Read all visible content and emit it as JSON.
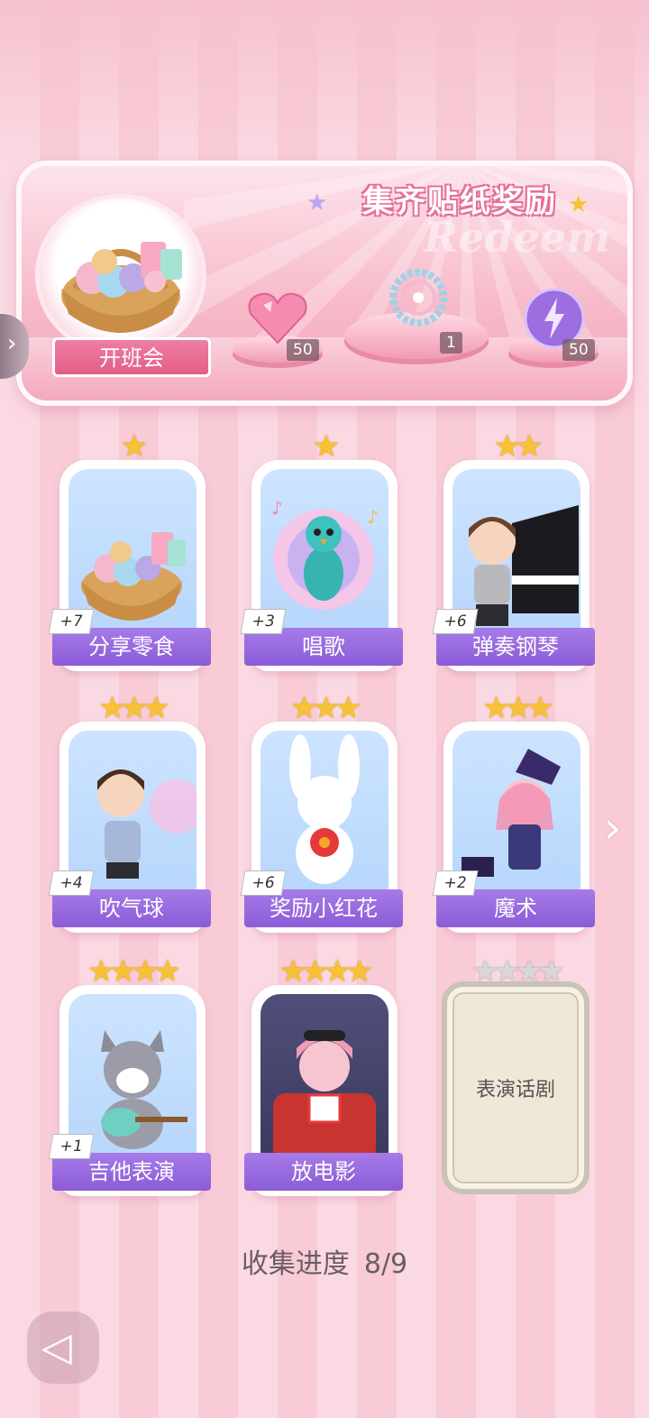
{
  "banner": {
    "title": "集齐贴纸奖励",
    "watermark": "Redeem",
    "class_meeting_label": "开班会",
    "rewards": [
      {
        "name": "pink-heart-gem",
        "count": "50"
      },
      {
        "name": "bracelet",
        "count": "1"
      },
      {
        "name": "purple-lightning-orb",
        "count": "50"
      }
    ]
  },
  "stickers": [
    {
      "label": "分享零食",
      "bonus": "+7",
      "stars": "★"
    },
    {
      "label": "唱歌",
      "bonus": "+3",
      "stars": "★"
    },
    {
      "label": "弹奏钢琴",
      "bonus": "+6",
      "stars": "★★"
    },
    {
      "label": "吹气球",
      "bonus": "+4",
      "stars": "★★★"
    },
    {
      "label": "奖励小红花",
      "bonus": "+6",
      "stars": "★★★"
    },
    {
      "label": "魔术",
      "bonus": "+2",
      "stars": "★★★"
    },
    {
      "label": "吉他表演",
      "bonus": "+1",
      "stars": "★★★★"
    },
    {
      "label": "放电影",
      "bonus": "",
      "stars": "★★★★"
    },
    {
      "label": "表演话剧",
      "bonus": "",
      "stars": "★★★★",
      "locked": true
    }
  ],
  "progress": {
    "label": "收集进度",
    "value": "8/9"
  },
  "icons": {
    "next": "chevron-right-icon",
    "back": "back-icon"
  }
}
